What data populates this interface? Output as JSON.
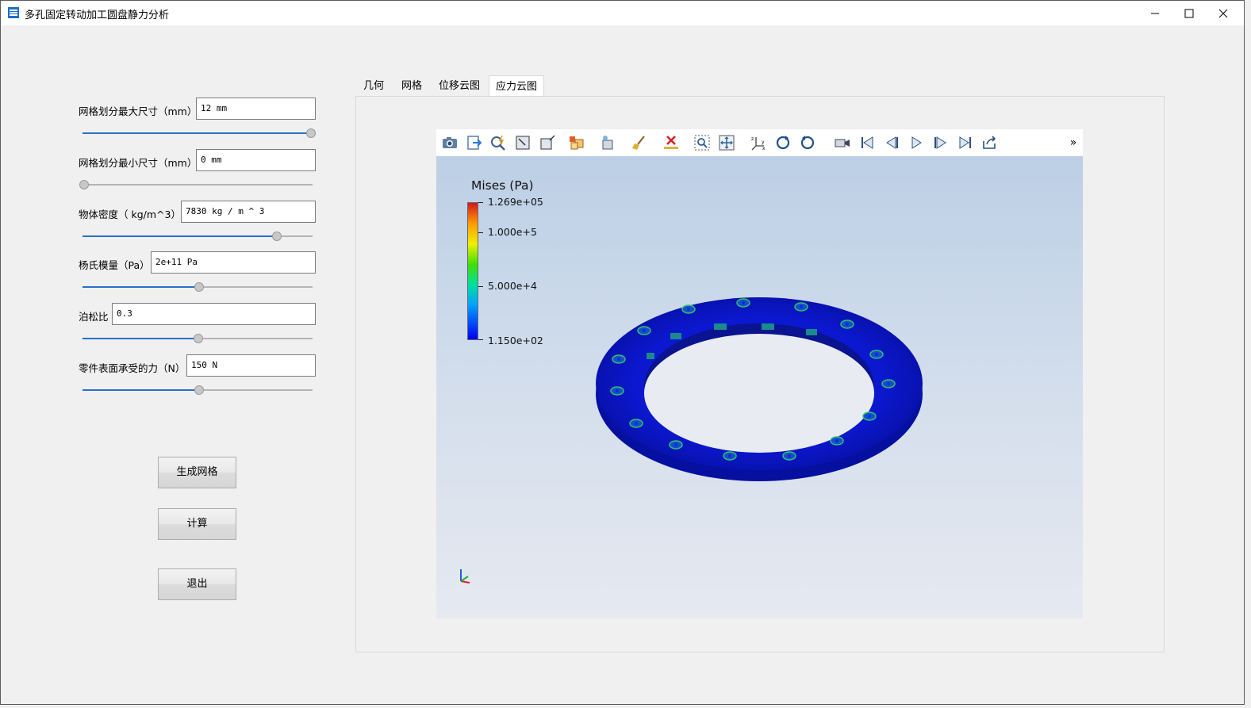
{
  "window": {
    "title": "多孔固定转动加工圆盘静力分析",
    "icon": "app-icon",
    "controls": [
      "minimize-icon",
      "maximize-icon",
      "close-icon"
    ]
  },
  "params": {
    "max_mesh": {
      "label": "网格划分最大尺寸（mm）",
      "value": "12 mm",
      "slider": 1.0
    },
    "min_mesh": {
      "label": "网格划分最小尺寸（mm）",
      "value": "0 mm",
      "slider": 0.0
    },
    "density": {
      "label": "物体密度（ kg/m^3）",
      "value": "7830 kg / m ^ 3",
      "slider": 0.84
    },
    "youngs": {
      "label": "杨氏模量（Pa）",
      "value": "2e+11 Pa",
      "slider": 0.5
    },
    "poisson": {
      "label": "泊松比",
      "value": "0.3",
      "slider": 0.5
    },
    "force": {
      "label": "零件表面承受的力（N）",
      "value": "150 N",
      "slider": 0.5
    }
  },
  "buttons": {
    "generate_mesh": "生成网格",
    "compute": "计算",
    "exit": "退出"
  },
  "tabs": [
    {
      "label": "几何",
      "active": false
    },
    {
      "label": "网格",
      "active": false
    },
    {
      "label": "位移云图",
      "active": false
    },
    {
      "label": "应力云图",
      "active": true
    }
  ],
  "viewer": {
    "toolbar_icons": [
      "camera-icon",
      "export-icon",
      "query-icon",
      "zoom-box-icon",
      "reset-view-icon",
      "split-view-icon",
      "representation-icon",
      "clear-icon",
      "delete-icon",
      "zoom-to-box-icon",
      "reset-camera-icon",
      "axes-orientation-icon",
      "rotate-ccw-icon",
      "rotate-cw-icon",
      "camera-record-icon",
      "first-frame-icon",
      "prev-frame-icon",
      "play-icon",
      "next-frame-icon",
      "last-frame-icon",
      "loop-icon",
      "more-icon"
    ],
    "more_label": "»",
    "colors": {
      "background_top": "#bccfe6",
      "background_bottom": "#e6e9f0",
      "disc": "#0a14c8"
    }
  },
  "legend": {
    "title": "Mises (Pa)",
    "labels": [
      "1.269e+05",
      "1.000e+5",
      "5.000e+4",
      "1.150e+02"
    ]
  }
}
